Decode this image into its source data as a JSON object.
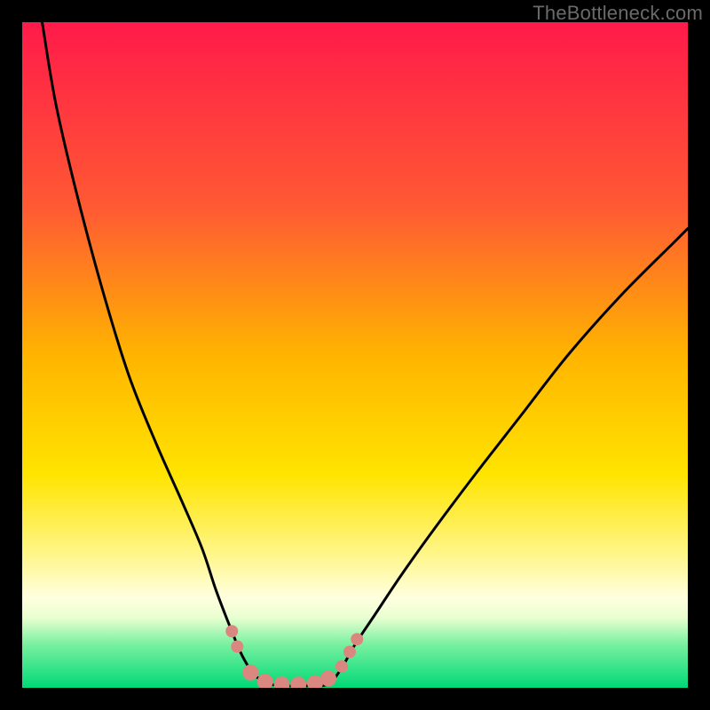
{
  "watermark": {
    "text": "TheBottleneck.com"
  },
  "chart_data": {
    "type": "line",
    "title": "",
    "xlabel": "",
    "ylabel": "",
    "xlim": [
      0,
      100
    ],
    "ylim": [
      0,
      100
    ],
    "grid": false,
    "legend": false,
    "background_gradient": {
      "stops": [
        {
          "offset": 0.0,
          "color": "#ff1a4a"
        },
        {
          "offset": 0.28,
          "color": "#ff5a33"
        },
        {
          "offset": 0.5,
          "color": "#ffb400"
        },
        {
          "offset": 0.68,
          "color": "#ffe400"
        },
        {
          "offset": 0.8,
          "color": "#fff68a"
        },
        {
          "offset": 0.865,
          "color": "#ffffe0"
        },
        {
          "offset": 0.895,
          "color": "#e8ffd0"
        },
        {
          "offset": 0.935,
          "color": "#78f0a0"
        },
        {
          "offset": 1.0,
          "color": "#00d977"
        }
      ]
    },
    "series": [
      {
        "name": "left-curve",
        "x": [
          3,
          5,
          8,
          12,
          16,
          20,
          24,
          27,
          29,
          30.5,
          31.5,
          32.5,
          33.5,
          35,
          37.5
        ],
        "y": [
          100,
          88,
          75,
          60,
          47,
          37,
          28,
          21,
          15,
          11,
          8.5,
          6,
          4,
          1.8,
          0.5
        ]
      },
      {
        "name": "valley-bottom",
        "x": [
          37.5,
          40,
          43,
          46
        ],
        "y": [
          0.5,
          0.3,
          0.3,
          0.6
        ]
      },
      {
        "name": "right-curve",
        "x": [
          46,
          48,
          50,
          53,
          57,
          62,
          68,
          75,
          82,
          90,
          98,
          100
        ],
        "y": [
          0.6,
          3,
          6.5,
          11,
          17,
          24,
          32,
          41,
          50,
          59,
          67,
          69
        ]
      }
    ],
    "markers": {
      "color": "#d9877f",
      "radius_small": 7,
      "radius_medium": 9,
      "points": [
        {
          "x": 31.5,
          "y": 8.5,
          "r": "small"
        },
        {
          "x": 32.3,
          "y": 6.2,
          "r": "small"
        },
        {
          "x": 34.3,
          "y": 2.3,
          "r": "medium"
        },
        {
          "x": 36.5,
          "y": 0.9,
          "r": "medium"
        },
        {
          "x": 39.0,
          "y": 0.5,
          "r": "medium"
        },
        {
          "x": 41.5,
          "y": 0.5,
          "r": "medium"
        },
        {
          "x": 44.0,
          "y": 0.7,
          "r": "medium"
        },
        {
          "x": 46.0,
          "y": 1.4,
          "r": "medium"
        },
        {
          "x": 48.0,
          "y": 3.2,
          "r": "small"
        },
        {
          "x": 49.2,
          "y": 5.4,
          "r": "small"
        },
        {
          "x": 50.3,
          "y": 7.3,
          "r": "small"
        }
      ]
    }
  }
}
